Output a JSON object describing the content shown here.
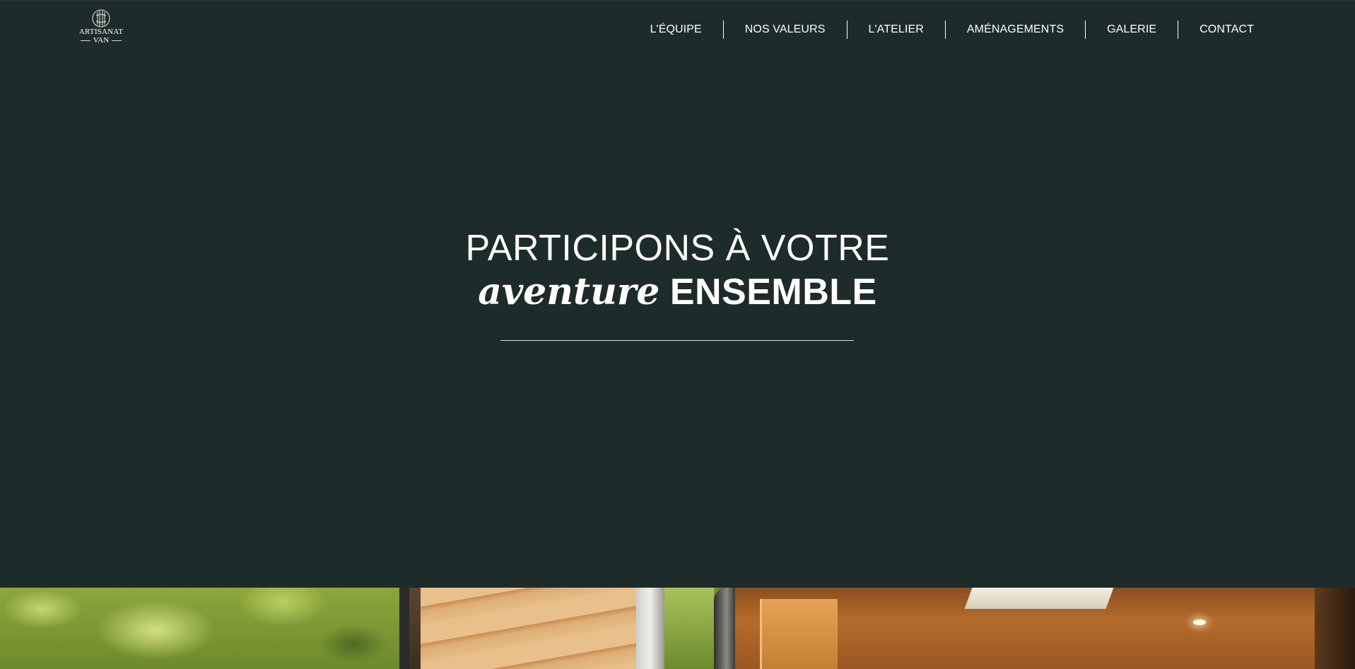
{
  "header": {
    "logo": {
      "line1": "ARTISANAT",
      "line2": "VAN",
      "icon": "logo-emblem-icon"
    },
    "nav": [
      {
        "label": "L'ÉQUIPE"
      },
      {
        "label": "NOS VALEURS"
      },
      {
        "label": "L'ATELIER"
      },
      {
        "label": "AMÉNAGEMENTS"
      },
      {
        "label": "GALERIE"
      },
      {
        "label": "CONTACT"
      }
    ]
  },
  "hero": {
    "line1": "PARTICIPONS À VOTRE",
    "line2_italic": "aventure",
    "line2_plain": "ENSEMBLE"
  },
  "photo": {
    "subject": "van-interior-photo"
  },
  "colors": {
    "background": "#1d2b2a",
    "text": "#ffffff",
    "divider": "#d7dcdb"
  }
}
